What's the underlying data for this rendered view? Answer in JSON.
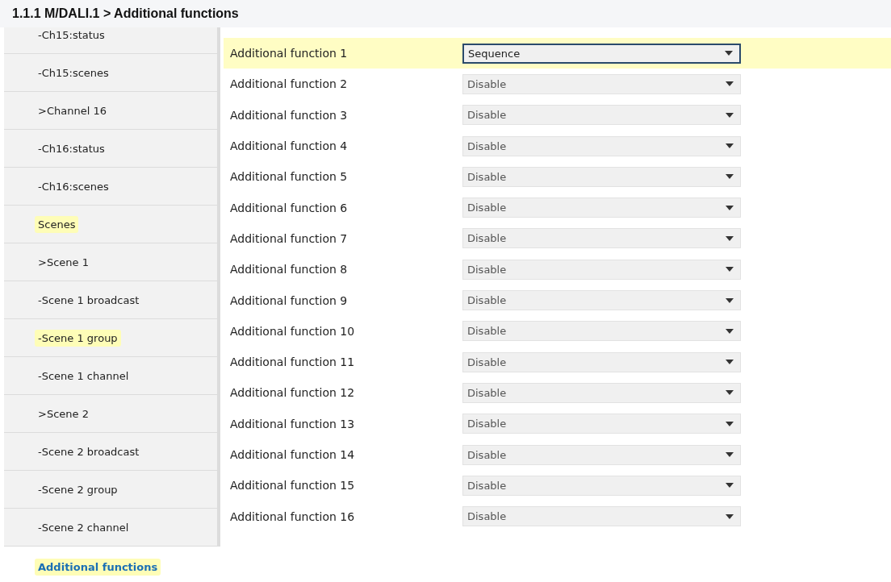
{
  "breadcrumb": "1.1.1 M/DALI.1 > Additional functions",
  "sidebar": {
    "items": [
      {
        "label": "-Ch15:status",
        "highlighted": false,
        "selected": false
      },
      {
        "label": "-Ch15:scenes",
        "highlighted": false,
        "selected": false
      },
      {
        "label": ">Channel 16",
        "highlighted": false,
        "selected": false
      },
      {
        "label": "-Ch16:status",
        "highlighted": false,
        "selected": false
      },
      {
        "label": "-Ch16:scenes",
        "highlighted": false,
        "selected": false
      },
      {
        "label": "Scenes",
        "highlighted": true,
        "selected": false
      },
      {
        "label": ">Scene 1",
        "highlighted": false,
        "selected": false
      },
      {
        "label": "-Scene 1 broadcast",
        "highlighted": false,
        "selected": false
      },
      {
        "label": "-Scene 1 group",
        "highlighted": true,
        "selected": false
      },
      {
        "label": "-Scene 1 channel",
        "highlighted": false,
        "selected": false
      },
      {
        "label": ">Scene 2",
        "highlighted": false,
        "selected": false
      },
      {
        "label": "-Scene 2 broadcast",
        "highlighted": false,
        "selected": false
      },
      {
        "label": "-Scene 2 group",
        "highlighted": false,
        "selected": false
      },
      {
        "label": "-Scene 2 channel",
        "highlighted": false,
        "selected": false
      }
    ],
    "current": {
      "label": "Additional functions",
      "highlighted": true,
      "selected": true
    }
  },
  "parameters": [
    {
      "label": "Additional function 1",
      "value": "Sequence",
      "highlighted": true,
      "focused": true
    },
    {
      "label": "Additional function 2",
      "value": "Disable",
      "highlighted": false,
      "focused": false
    },
    {
      "label": "Additional function 3",
      "value": "Disable",
      "highlighted": false,
      "focused": false
    },
    {
      "label": "Additional function 4",
      "value": "Disable",
      "highlighted": false,
      "focused": false
    },
    {
      "label": "Additional function 5",
      "value": "Disable",
      "highlighted": false,
      "focused": false
    },
    {
      "label": "Additional function 6",
      "value": "Disable",
      "highlighted": false,
      "focused": false
    },
    {
      "label": "Additional function 7",
      "value": "Disable",
      "highlighted": false,
      "focused": false
    },
    {
      "label": "Additional function 8",
      "value": "Disable",
      "highlighted": false,
      "focused": false
    },
    {
      "label": "Additional function 9",
      "value": "Disable",
      "highlighted": false,
      "focused": false
    },
    {
      "label": "Additional function 10",
      "value": "Disable",
      "highlighted": false,
      "focused": false
    },
    {
      "label": "Additional function 11",
      "value": "Disable",
      "highlighted": false,
      "focused": false
    },
    {
      "label": "Additional function 12",
      "value": "Disable",
      "highlighted": false,
      "focused": false
    },
    {
      "label": "Additional function 13",
      "value": "Disable",
      "highlighted": false,
      "focused": false
    },
    {
      "label": "Additional function 14",
      "value": "Disable",
      "highlighted": false,
      "focused": false
    },
    {
      "label": "Additional function 15",
      "value": "Disable",
      "highlighted": false,
      "focused": false
    },
    {
      "label": "Additional function 16",
      "value": "Disable",
      "highlighted": false,
      "focused": false
    }
  ]
}
